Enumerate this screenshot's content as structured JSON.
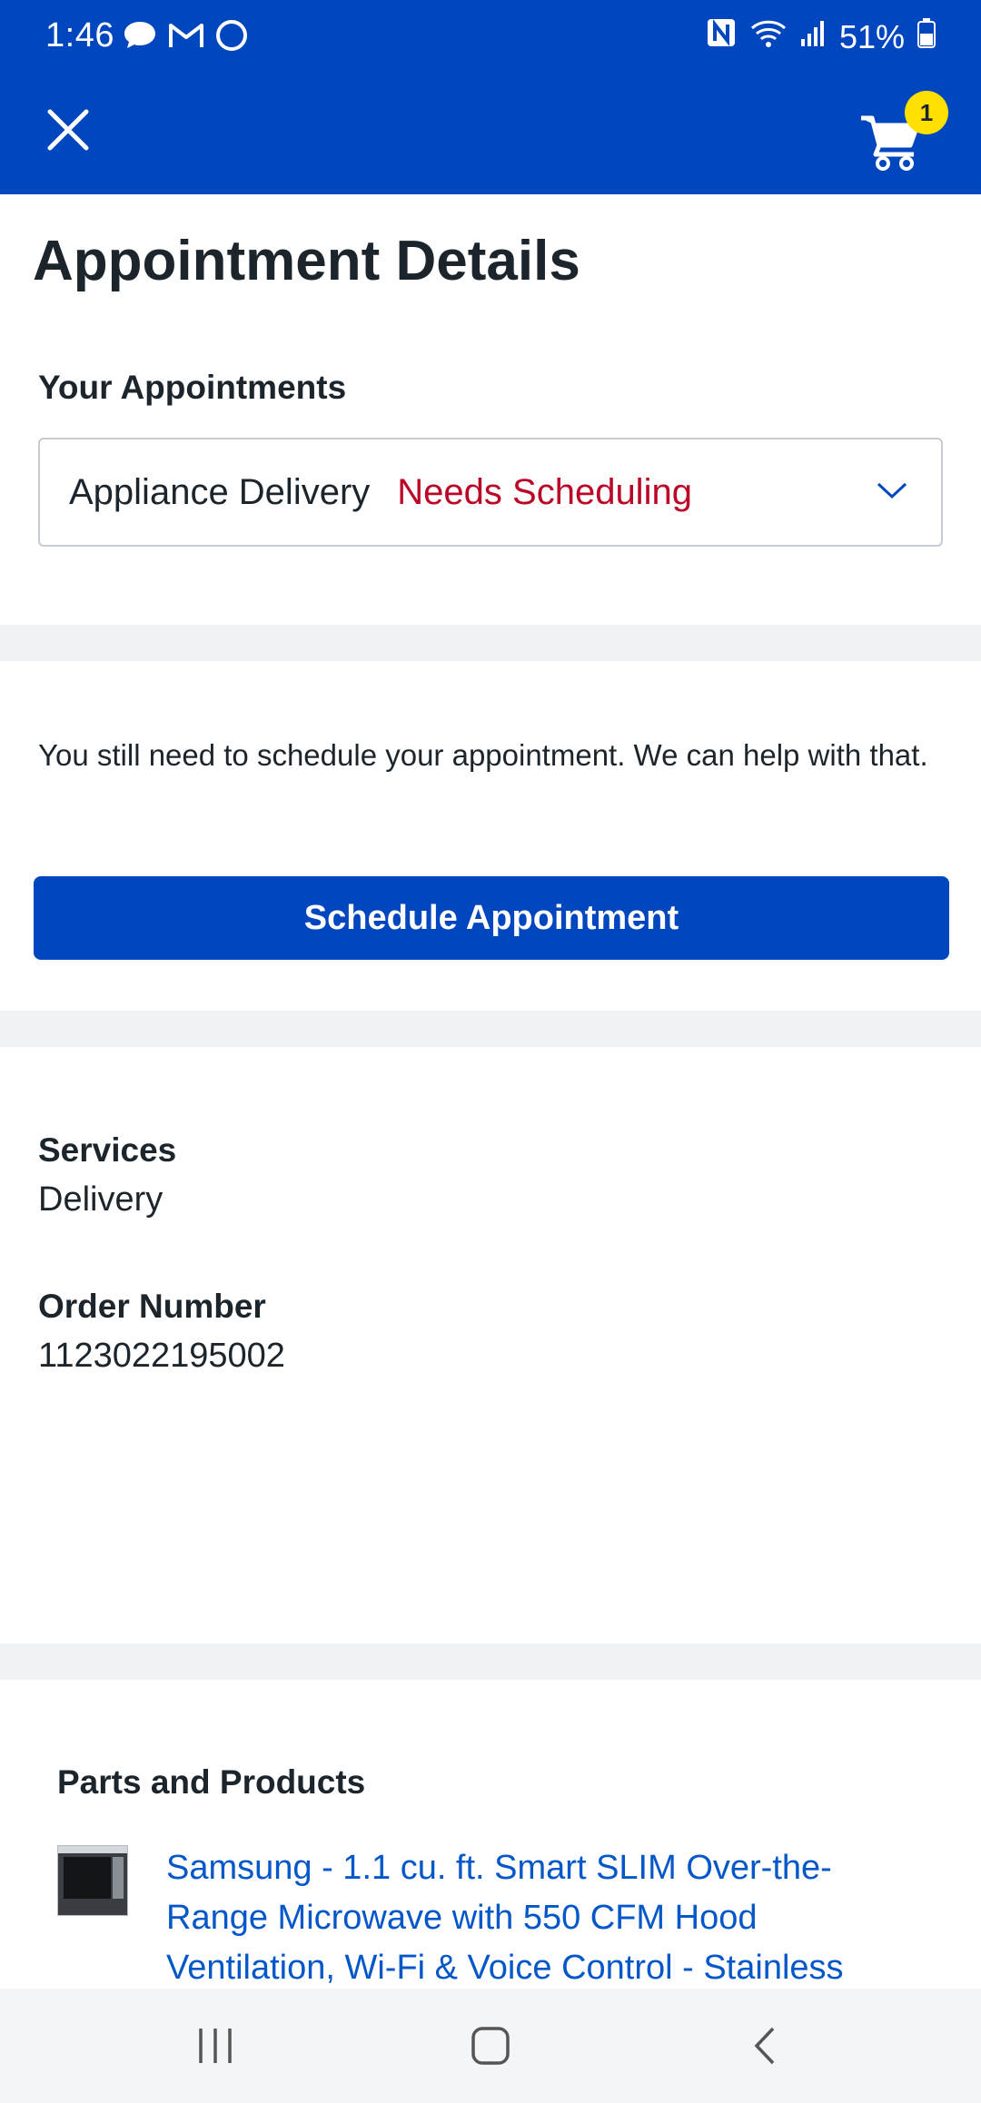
{
  "status_bar": {
    "time": "1:46",
    "battery": "51%",
    "left_icons": [
      "chat-bubble-icon",
      "gmail-icon",
      "alexa-icon"
    ],
    "right_icons": [
      "nfc-icon",
      "wifi-icon",
      "signal-icon",
      "battery-icon"
    ]
  },
  "header": {
    "cart_count": "1",
    "colors": {
      "bar": "#0046be",
      "badge": "#ffe000"
    }
  },
  "page": {
    "title": "Appointment Details"
  },
  "appointments": {
    "heading": "Your Appointments",
    "selected_type": "Appliance Delivery",
    "selected_status": "Needs Scheduling",
    "status_color": "#bb0628"
  },
  "schedule": {
    "message": "You still need to schedule your appointment. We can help with that.",
    "button_label": "Schedule Appointment"
  },
  "details": {
    "services_label": "Services",
    "services_value": "Delivery",
    "order_label": "Order Number",
    "order_value": "1123022195002"
  },
  "products": {
    "heading": "Parts and Products",
    "items": [
      {
        "title": "Samsung - 1.1 cu. ft. Smart SLIM Over-the-Range Microwave with 550 CFM Hood Ventilation, Wi-Fi & Voice Control - Stainless"
      }
    ]
  },
  "nav_bar": {
    "icons": [
      "recent-apps-icon",
      "home-icon",
      "back-icon"
    ]
  }
}
